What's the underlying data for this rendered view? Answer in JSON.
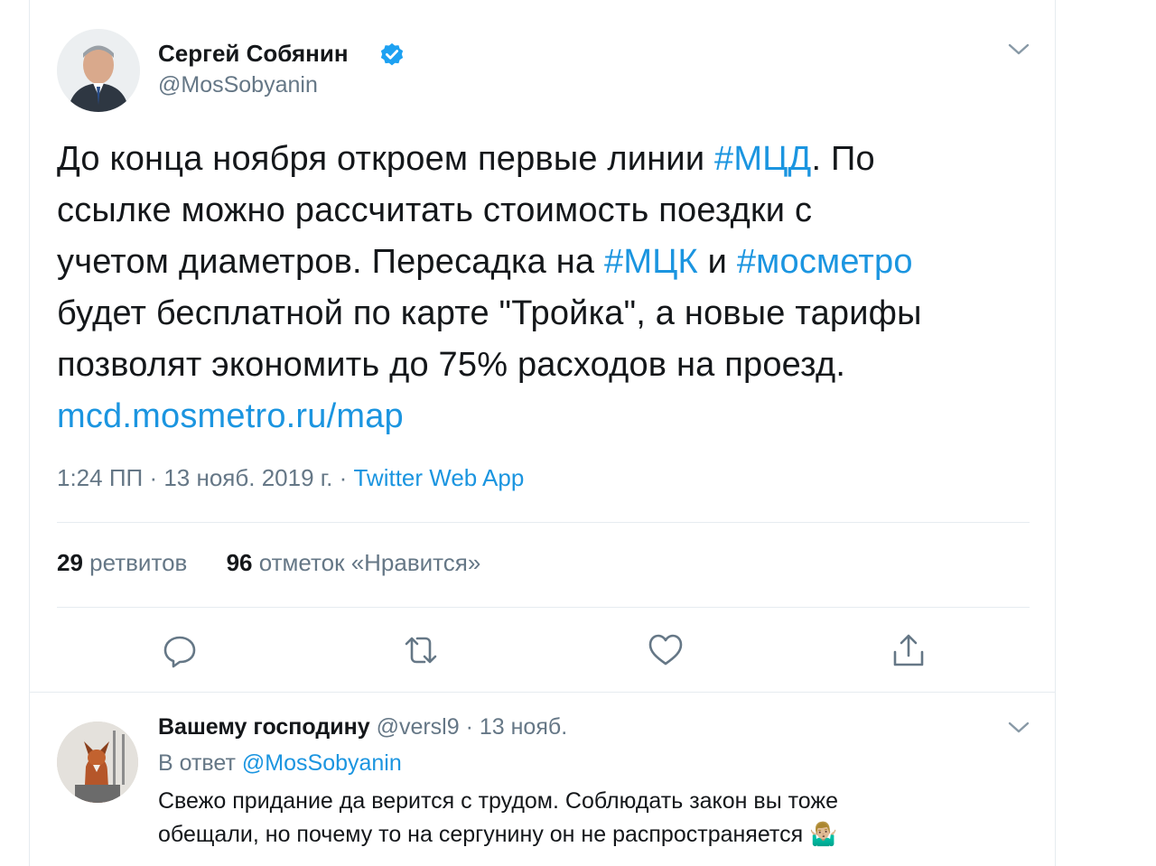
{
  "main_tweet": {
    "author_name": "Сергей Собянин",
    "handle": "@MosSobyanin",
    "text_lines": [
      [
        {
          "t": "До конца ноября откроем первые линии "
        },
        {
          "t": "#МЦД",
          "link": true
        },
        {
          "t": ". По"
        }
      ],
      [
        {
          "t": "ссылке можно рассчитать стоимость поездки с"
        }
      ],
      [
        {
          "t": "учетом диаметров. Пересадка на "
        },
        {
          "t": "#МЦК",
          "link": true
        },
        {
          "t": " и "
        },
        {
          "t": "#мосметро",
          "link": true
        }
      ],
      [
        {
          "t": "будет бесплатной по карте \"Тройка\", а новые тарифы"
        }
      ],
      [
        {
          "t": "позволят экономить до 75% расходов на проезд."
        }
      ],
      [
        {
          "t": "mcd.mosmetro.ru/map",
          "link": true
        }
      ]
    ],
    "time": "1:24 ПП",
    "date": "13 нояб. 2019 г.",
    "sep": "·",
    "source": "Twitter Web App",
    "retweets_count": "29",
    "retweets_label": "ретвитов",
    "likes_count": "96",
    "likes_label": "отметок «Нравится»",
    "icons": {
      "verified": "verified-badge-icon",
      "menu": "chevron-down-icon",
      "reply": "reply-icon",
      "retweet": "retweet-icon",
      "like": "heart-icon",
      "share": "share-icon"
    }
  },
  "reply": {
    "author_name": "Вашему господину",
    "handle": "@versl9",
    "sep": "·",
    "date": "13 нояб.",
    "reply_prefix": "В ответ",
    "reply_to": "@MosSobyanin",
    "text_lines": [
      "Свежо придание да верится с трудом. Соблюдать закон вы тоже",
      "обещали, но почему то на сергунину он не распространяется"
    ],
    "emoji": "🤷🏼‍♂️"
  },
  "colors": {
    "accent": "#1da1f2",
    "link": "#1b95e0",
    "secondary_text": "#657786",
    "border": "#e6ecf0"
  }
}
